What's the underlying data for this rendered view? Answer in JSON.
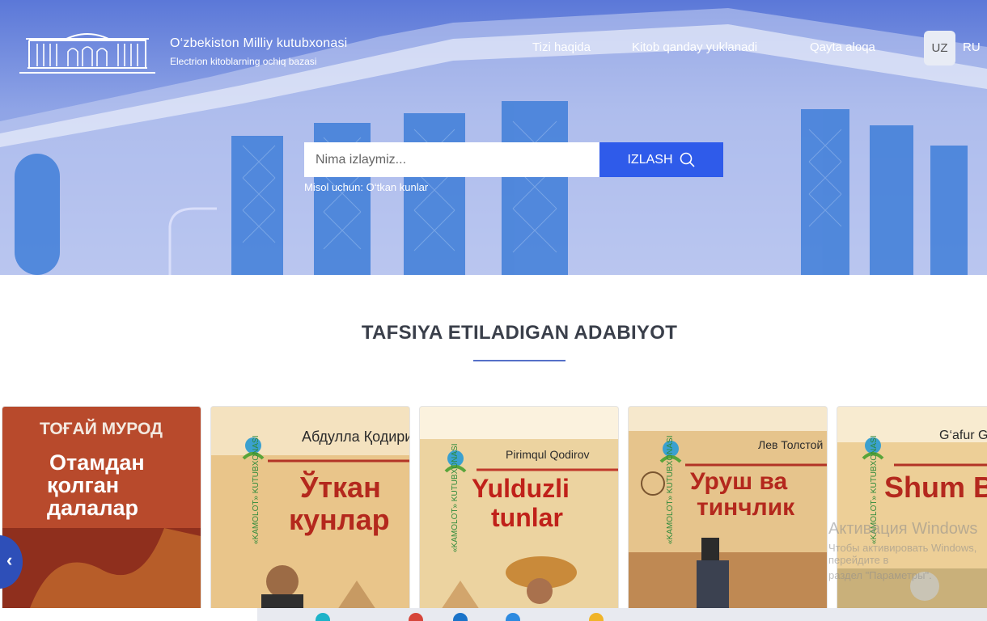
{
  "brand": {
    "title": "O‘zbekiston Milliy kutubxonasi",
    "subtitle": "Electrion kitoblarning ochiq bazasi"
  },
  "nav": {
    "items": [
      "Tizi haqida",
      "Kitob qanday yuklanadi",
      "Qayta aloqa"
    ],
    "lang_active": "UZ",
    "lang_other": "RU"
  },
  "search": {
    "placeholder": "Nima izlaymiz...",
    "button_label": "IZLASH",
    "hint": "Misol uchun: O‘tkan kunlar"
  },
  "section": {
    "title": "TAFSIYA ETILADIGAN ADABIYOT"
  },
  "books": [
    {
      "author": "ТОҒАЙ МУРОД",
      "title": [
        "Отамдан",
        "қолган",
        "далалар"
      ],
      "bg": "#b84a2c"
    },
    {
      "author": "Абдулла Қодирий",
      "title": [
        "Ўткан",
        "кунлар"
      ],
      "bg": "#e9c58a"
    },
    {
      "author": "Pirimqul Qodirov",
      "title": [
        "Yulduzli",
        "tunlar"
      ],
      "bg": "#ecd3a0"
    },
    {
      "author": "Лев Толстой",
      "title": [
        "Уруш ва",
        "тинчлик"
      ],
      "bg": "#e6c48c"
    },
    {
      "author": "G‘afur G‘ulom",
      "title": [
        "Shum BOL"
      ],
      "bg": "#edcf97"
    }
  ],
  "publisher_badge": "«KAMOLOT» KUTUBXONASI",
  "watermark": {
    "line1": "Активация Windows",
    "line2": "Чтобы активировать Windows, перейдите в",
    "line3": "раздел \"Параметры\"."
  },
  "colors": {
    "accent": "#2f5bea",
    "hero": "#6d86dc"
  }
}
